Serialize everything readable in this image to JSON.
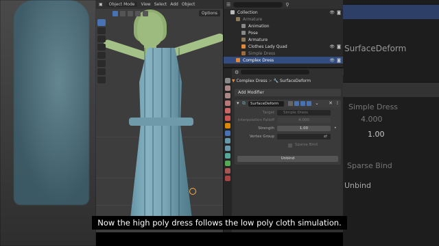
{
  "viewport": {
    "mode_label": "Object Mode",
    "menu": [
      "View",
      "Select",
      "Add",
      "Object"
    ],
    "options_label": "Options"
  },
  "outliner": {
    "rows": [
      {
        "label": "Collection"
      },
      {
        "label": "Armature"
      },
      {
        "label": "Animation"
      },
      {
        "label": "Pose"
      },
      {
        "label": "Armature"
      },
      {
        "label": "Clothes Lady Quad"
      },
      {
        "label": "Simple Dress"
      },
      {
        "label": "Complex Dress"
      }
    ]
  },
  "properties": {
    "breadcrumb_object": "Complex Dress",
    "breadcrumb_separator": ">",
    "breadcrumb_modifier": "SurfaceDeform",
    "add_modifier_label": "Add Modifier",
    "modifier": {
      "name": "SurfaceDeform",
      "target_label": "Target",
      "target_value": "Simple Dress",
      "falloff_label": "Interpolation Falloff",
      "falloff_value": "4.000",
      "strength_label": "Strength",
      "strength_value": "1.00",
      "vgroup_label": "Vertex Group",
      "sparse_bind_label": "Sparse Bind",
      "unbind_label": "Unbind"
    }
  },
  "right_backdrop": {
    "modifier_name": "SurfaceDeform",
    "target_value": "Simple Dress",
    "falloff_value": "4.000",
    "strength_value": "1.00",
    "sparse_bind_label": "Sparse Bind",
    "unbind_label": "Unbind"
  },
  "caption": "Now the high poly dress follows the low poly cloth simulation.",
  "colors": {
    "selection": "#334d80",
    "accent": "#4772b3",
    "dress": "#7aa7b7",
    "mannequin": "#9dbb7e"
  }
}
